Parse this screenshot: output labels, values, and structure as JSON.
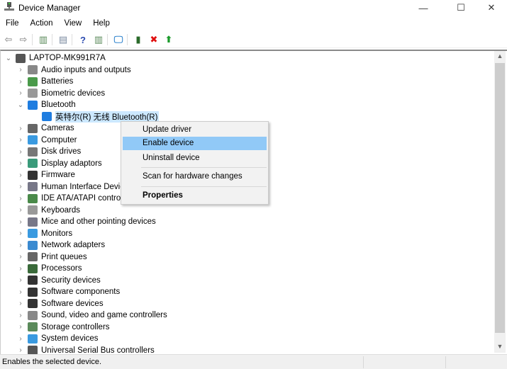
{
  "window": {
    "title": "Device Manager",
    "minimize": "—",
    "maximize": "☐",
    "close": "✕"
  },
  "menu": [
    "File",
    "Action",
    "View",
    "Help"
  ],
  "toolbar": [
    {
      "icon": "back-arrow-icon",
      "glyph": "⇦",
      "color": "#9a9a9a"
    },
    {
      "icon": "forward-arrow-icon",
      "glyph": "⇨",
      "color": "#9a9a9a"
    },
    {
      "icon": "show-hide-console-tree-icon",
      "glyph": "▥",
      "color": "#5a8a5a"
    },
    {
      "icon": "properties-icon",
      "glyph": "▤",
      "color": "#7a8aa0"
    },
    {
      "icon": "help-icon",
      "glyph": "?",
      "color": "#2a4ab0"
    },
    {
      "icon": "action-pane-icon",
      "glyph": "▥",
      "color": "#5a8a5a"
    },
    {
      "icon": "scan-hardware-icon",
      "glyph": "🖵",
      "color": "#3a8ad0"
    },
    {
      "icon": "update-driver-icon",
      "glyph": "▮",
      "color": "#2a6a2a"
    },
    {
      "icon": "uninstall-icon",
      "glyph": "✖",
      "color": "#e01010"
    },
    {
      "icon": "enable-device-icon",
      "glyph": "⬆",
      "color": "#1a9a2a"
    }
  ],
  "tree": {
    "root": "LAPTOP-MK991R7A",
    "items": [
      {
        "label": "Audio inputs and outputs",
        "color": "#888"
      },
      {
        "label": "Batteries",
        "color": "#4a9a4a"
      },
      {
        "label": "Biometric devices",
        "color": "#999"
      },
      {
        "label": "Bluetooth",
        "color": "#1f7de0",
        "expanded": true
      },
      {
        "label": "英特尔(R) 无线 Bluetooth(R)",
        "color": "#1f7de0",
        "child": true,
        "selected": true
      },
      {
        "label": "Cameras",
        "color": "#666"
      },
      {
        "label": "Computer",
        "color": "#3a9ae0"
      },
      {
        "label": "Disk drives",
        "color": "#777"
      },
      {
        "label": "Display adaptors",
        "color": "#3a9a7a"
      },
      {
        "label": "Firmware",
        "color": "#333"
      },
      {
        "label": "Human Interface Devices",
        "color": "#778"
      },
      {
        "label": "IDE ATA/ATAPI controllers",
        "color": "#4a8a4a"
      },
      {
        "label": "Keyboards",
        "color": "#999"
      },
      {
        "label": "Mice and other pointing devices",
        "color": "#778"
      },
      {
        "label": "Monitors",
        "color": "#3a9ae0"
      },
      {
        "label": "Network adapters",
        "color": "#3a8ad0"
      },
      {
        "label": "Print queues",
        "color": "#666"
      },
      {
        "label": "Processors",
        "color": "#3a6a3a"
      },
      {
        "label": "Security devices",
        "color": "#333"
      },
      {
        "label": "Software components",
        "color": "#333"
      },
      {
        "label": "Software devices",
        "color": "#333"
      },
      {
        "label": "Sound, video and game controllers",
        "color": "#888"
      },
      {
        "label": "Storage controllers",
        "color": "#5a8a5a"
      },
      {
        "label": "System devices",
        "color": "#3a9ae0"
      },
      {
        "label": "Universal Serial Bus controllers",
        "color": "#555"
      }
    ]
  },
  "context_menu": {
    "items": [
      "Update driver",
      "Enable device",
      "Uninstall device",
      "Scan for hardware changes",
      "Properties"
    ],
    "highlighted": "Enable device",
    "highlight_color": "#91c9f7"
  },
  "status": {
    "text": "Enables the selected device."
  }
}
